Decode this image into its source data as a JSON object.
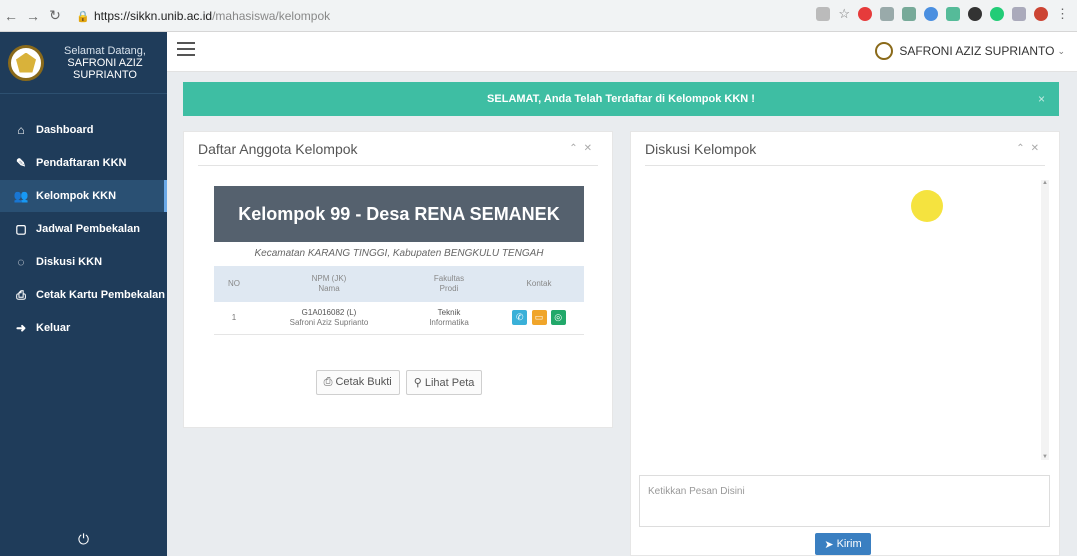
{
  "browser": {
    "url_host": "https://sikkn.unib.ac.id",
    "url_path": "/mahasiswa/kelompok"
  },
  "sidebar": {
    "welcome": "Selamat Datang,",
    "user_name": "SAFRONI AZIZ SUPRIANTO",
    "items": [
      {
        "label": "Dashboard",
        "icon": "home-icon"
      },
      {
        "label": "Pendaftaran KKN",
        "icon": "edit-icon"
      },
      {
        "label": "Kelompok KKN",
        "icon": "users-icon"
      },
      {
        "label": "Jadwal Pembekalan",
        "icon": "calendar-icon"
      },
      {
        "label": "Diskusi KKN",
        "icon": "chat-icon"
      },
      {
        "label": "Cetak Kartu Pembekalan",
        "icon": "print-icon"
      },
      {
        "label": "Keluar",
        "icon": "logout-icon"
      }
    ],
    "active_index": 2
  },
  "topbar": {
    "user_label": "SAFRONI AZIZ SUPRIANTO"
  },
  "alert": {
    "message": "SELAMAT, Anda Telah Terdaftar di Kelompok KKN !",
    "close": "×"
  },
  "anggota": {
    "title": "Daftar Anggota Kelompok",
    "kelompok": "Kelompok 99 - Desa RENA SEMANEK",
    "kecamatan": "Kecamatan KARANG TINGGI, Kabupaten BENGKULU TENGAH",
    "headers": {
      "no": "NO",
      "npm": "NPM (JK)",
      "nama": "Nama",
      "fakultas": "Fakultas",
      "prodi": "Prodi",
      "kontak": "Kontak"
    },
    "rows": [
      {
        "no": "1",
        "npm": "G1A016082 (L)",
        "nama": "Safroni Aziz Suprianto",
        "fakultas": "Teknik",
        "prodi": "Informatika"
      }
    ],
    "btn_cetak": "Cetak Bukti",
    "btn_peta": "Lihat Peta"
  },
  "diskusi": {
    "title": "Diskusi Kelompok",
    "placeholder": "Ketikkan Pesan Disini",
    "send": "Kirim"
  },
  "colors": {
    "sidebar": "#1f3c5a",
    "alert": "#3ebea3",
    "banner": "#55616e",
    "send": "#3a7fc1"
  }
}
